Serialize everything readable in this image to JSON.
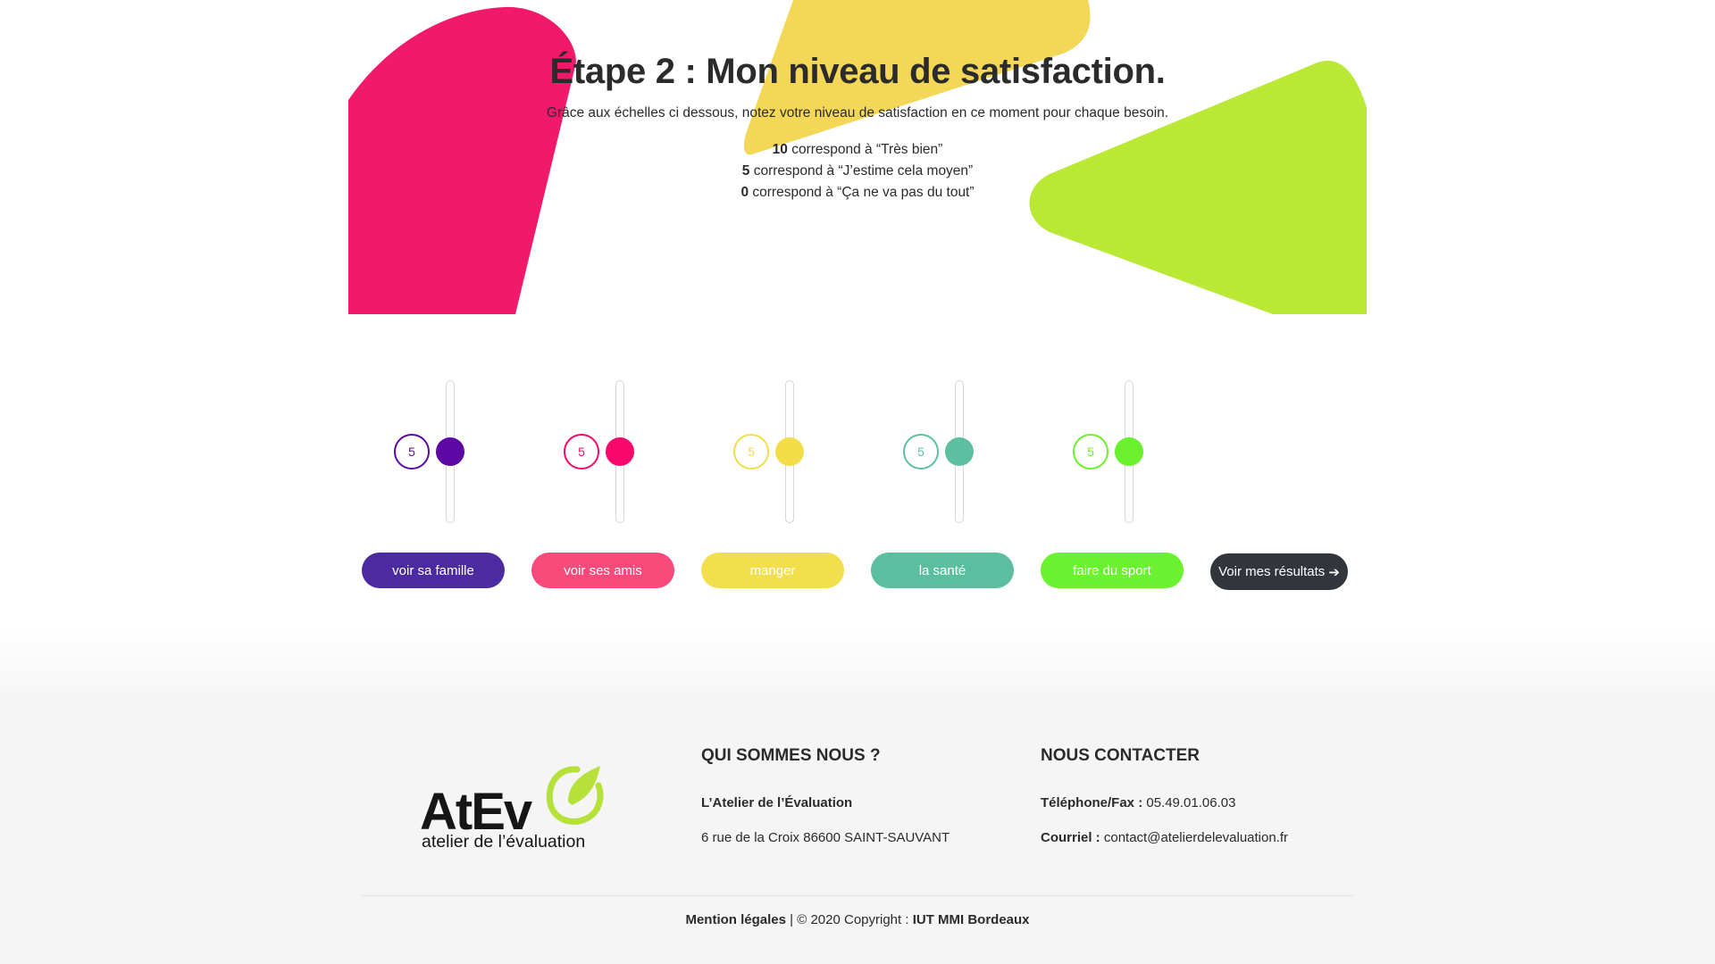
{
  "hero": {
    "title": "Étape 2 : Mon niveau de satisfaction.",
    "subtitle": "Grâce aux échelles ci dessous, notez votre niveau de satisfaction en ce moment pour chaque besoin.",
    "scale": [
      {
        "value": "10",
        "text": " correspond à “Très bien”"
      },
      {
        "value": "5",
        "text": " correspond à “J’estime cela moyen”"
      },
      {
        "value": "0",
        "text": " correspond à “Ça ne va pas du tout”"
      }
    ],
    "shape_colors": {
      "pink": "#f2196b",
      "yellow": "#f5d757",
      "green": "#b9e935"
    }
  },
  "sliders": [
    {
      "label": "voir sa famille",
      "value": "5",
      "color": "#5e08a3",
      "button_color": "#4c2ba0"
    },
    {
      "label": "voir ses amis",
      "value": "5",
      "color": "#f7086a",
      "button_color": "#f84a7b"
    },
    {
      "label": "manger",
      "value": "5",
      "color": "#f3dd48",
      "button_color": "#f1df4d"
    },
    {
      "label": "la santé",
      "value": "5",
      "color": "#5cc0a0",
      "button_color": "#5abe9f"
    },
    {
      "label": "faire du sport",
      "value": "5",
      "color": "#6af02c",
      "button_color": "#6af230"
    }
  ],
  "slider_range": {
    "min": 0,
    "max": 10
  },
  "results_button": {
    "label": "Voir mes résultats",
    "arrow": "➔"
  },
  "footer": {
    "logo": {
      "word": "AtEv",
      "subtitle": "atelier de l’évaluation",
      "accent_color": "#b5e13a"
    },
    "about": {
      "heading": "QUI SOMMES NOUS ?",
      "name": "L’Atelier de l’Évaluation",
      "address": "6 rue de la Croix 86600 SAINT-SAUVANT"
    },
    "contact": {
      "heading": "NOUS CONTACTER",
      "phone_label": "Téléphone/Fax :",
      "phone": " 05.49.01.06.03",
      "email_label": "Courriel :",
      "email": " contact@atelierdelevaluation.fr"
    },
    "copyright": {
      "legal": "Mention légales",
      "separator": " | © 2020 Copyright : ",
      "owner": "IUT MMI Bordeaux"
    }
  }
}
